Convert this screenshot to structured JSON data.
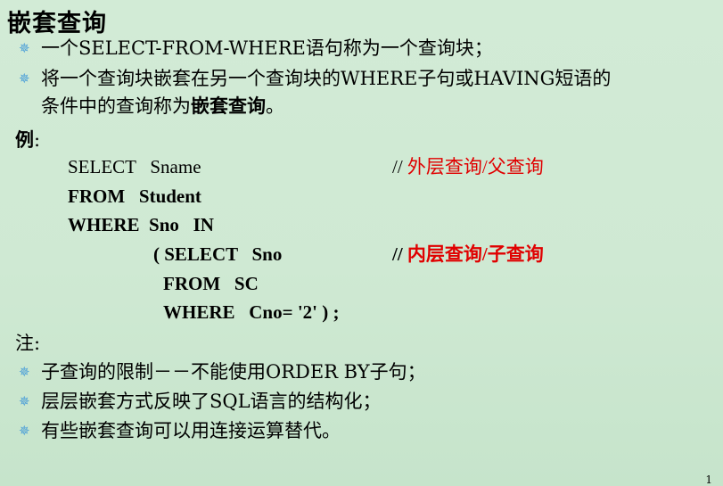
{
  "title": "嵌套查询",
  "bullets_top": [
    {
      "text": "一个SELECT-FROM-WHERE语句称为一个查询块；"
    },
    {
      "text_pre": "将一个查询块嵌套在另一个查询块的WHERE子句或HAVING短语的",
      "text_cont": "条件中的查询称为",
      "text_bold": "嵌套查询",
      "text_end": "。"
    }
  ],
  "example_label": "例",
  "example_colon": ":",
  "code": {
    "line1": "SELECT   Sname",
    "line1_comment_prefix": "// ",
    "line1_comment": "外层查询/父查询",
    "line2": "FROM   Student",
    "line3": "WHERE  Sno   IN",
    "line4": "( SELECT   Sno",
    "line4_comment_prefix": "// ",
    "line4_comment": "内层查询/子查询",
    "line5": "FROM   SC",
    "line6": "WHERE   Cno= '2' ) ;"
  },
  "note_label": "注:",
  "bullets_bottom": [
    {
      "text": "子查询的限制－－不能使用ORDER  BY子句；"
    },
    {
      "text": "层层嵌套方式反映了SQL语言的结构化；"
    },
    {
      "text": "有些嵌套查询可以用连接运算替代。"
    }
  ],
  "bullet_icon": "✵",
  "colors": {
    "comment": "#e00000",
    "bullet": "#4a9ed8",
    "background": "#d2ebd6"
  },
  "page_number": "1"
}
